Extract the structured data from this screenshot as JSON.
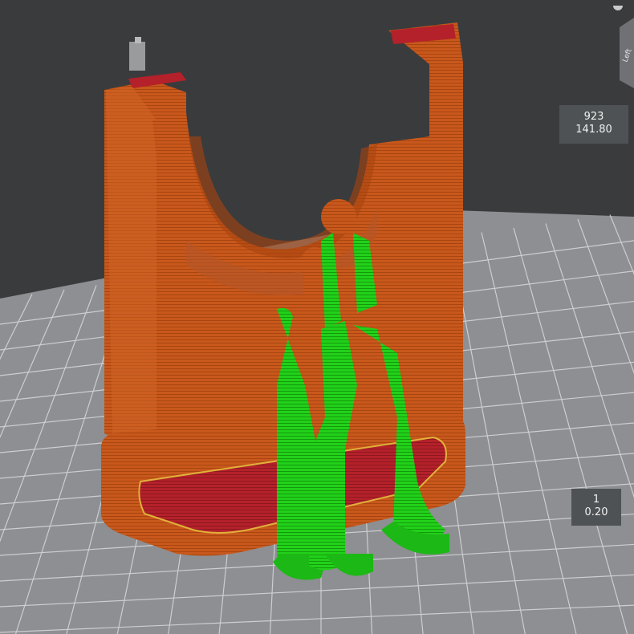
{
  "app": {
    "view": "3d-slicer-preview"
  },
  "layer_slider": {
    "top": {
      "layer": "923",
      "height": "141.80"
    },
    "bottom": {
      "layer": "1",
      "height": "0.20"
    }
  },
  "view_cube": {
    "face_label": "Left"
  },
  "colors": {
    "background": "#3a3b3d",
    "bed_grid": "#8d8f92",
    "model_orange": "#c8581c",
    "model_red": "#b4212a",
    "support_green": "#22d11a",
    "label_bg": "#4f5255"
  }
}
